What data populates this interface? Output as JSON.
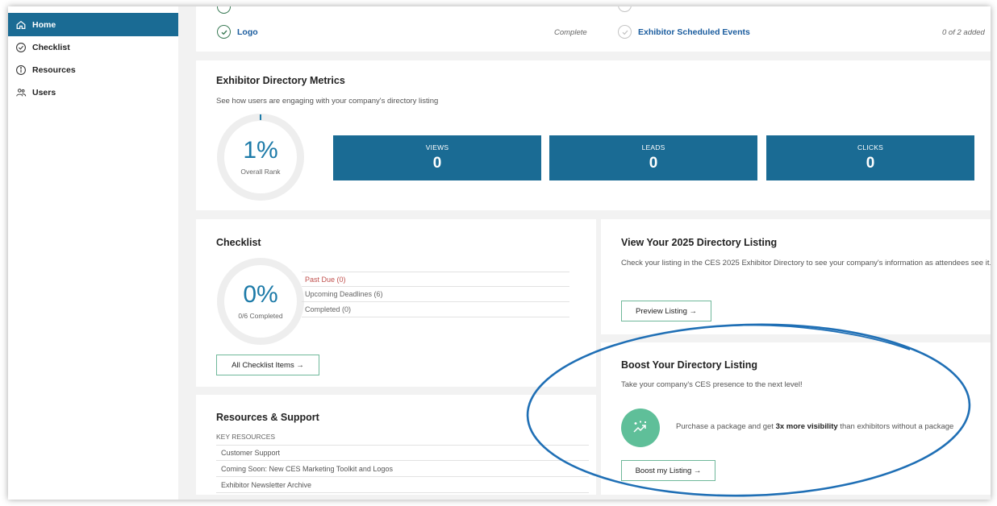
{
  "sidebar": {
    "items": [
      {
        "label": "Home",
        "icon": "home-icon",
        "active": true
      },
      {
        "label": "Checklist",
        "icon": "check-circle-icon",
        "active": false
      },
      {
        "label": "Resources",
        "icon": "info-icon",
        "active": false
      },
      {
        "label": "Users",
        "icon": "users-icon",
        "active": false
      }
    ]
  },
  "top_strip": {
    "left_item": {
      "label": "Logo",
      "status": "Complete"
    },
    "right_item": {
      "label": "Exhibitor Scheduled Events",
      "status": "0 of 2 added"
    }
  },
  "metrics": {
    "title": "Exhibitor Directory Metrics",
    "subtitle": "See how users are engaging with your company's directory listing",
    "rank_percent": "1%",
    "rank_label": "Overall Rank",
    "rank_fraction": 0.01,
    "boxes": [
      {
        "label": "VIEWS",
        "value": "0"
      },
      {
        "label": "LEADS",
        "value": "0"
      },
      {
        "label": "CLICKS",
        "value": "0"
      }
    ]
  },
  "checklist": {
    "title": "Checklist",
    "percent": "0%",
    "completed_label": "0/6 Completed",
    "rows": [
      {
        "label": "Past Due (0)",
        "kind": "due"
      },
      {
        "label": "Upcoming Deadlines (6)",
        "kind": "normal"
      },
      {
        "label": "Completed (0)",
        "kind": "normal"
      }
    ],
    "button": "All Checklist Items →"
  },
  "directory_listing": {
    "title": "View Your 2025 Directory Listing",
    "description": "Check your listing in the CES 2025 Exhibitor Directory to see your company's information as attendees see it.",
    "button": "Preview Listing →"
  },
  "boost": {
    "title": "Boost Your Directory Listing",
    "subtitle": "Take your company's CES presence to the next level!",
    "text_before": "Purchase a package and get ",
    "text_bold": "3x more visibility",
    "text_after": " than exhibitors without a package",
    "button": "Boost my Listing →",
    "icon": "trending-up-sparkle-icon"
  },
  "resources": {
    "title": "Resources & Support",
    "section_label": "KEY RESOURCES",
    "rows": [
      "Customer Support",
      "Coming Soon: New CES Marketing Toolkit and Logos",
      "Exhibitor Newsletter Archive"
    ]
  },
  "colors": {
    "primary": "#1a6b94",
    "accent_green": "#5fbf99",
    "link_blue": "#1a5c9e",
    "due_red": "#c0504d",
    "annotation_blue": "#1f6fb5"
  }
}
